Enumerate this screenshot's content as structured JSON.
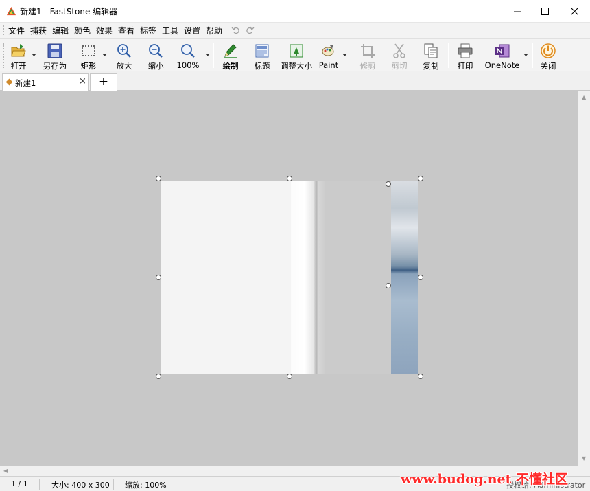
{
  "window": {
    "title": "新建1 - FastStone 编辑器",
    "minimize_icon": "minimize-icon",
    "maximize_icon": "maximize-icon",
    "close_icon": "close-icon"
  },
  "menu": {
    "items": [
      "文件",
      "捕获",
      "编辑",
      "颜色",
      "效果",
      "查看",
      "标签",
      "工具",
      "设置",
      "帮助"
    ]
  },
  "toolbar": {
    "open": "打开",
    "save_as": "另存为",
    "rectangle": "矩形",
    "zoom_in": "放大",
    "zoom_out": "缩小",
    "zoom_100": "100%",
    "draw": "绘制",
    "caption": "标题",
    "resize": "调整大小",
    "paint": "Paint",
    "crop": "修剪",
    "cut": "剪切",
    "copy": "复制",
    "print": "打印",
    "onenote": "OneNote",
    "close": "关闭"
  },
  "tabs": {
    "active": "新建1",
    "close_glyph": "×",
    "add_glyph": "+"
  },
  "status": {
    "page": "1 / 1",
    "size": "大小: 400 x 300",
    "zoom": "缩放: 100%",
    "right": "授权给: Administrator"
  },
  "watermark": "www.budog.net 不懂社区",
  "colors": {
    "canvas": "#c8c8c8",
    "accent_green": "#2e8b2e",
    "watermark": "#ff2a2a"
  }
}
